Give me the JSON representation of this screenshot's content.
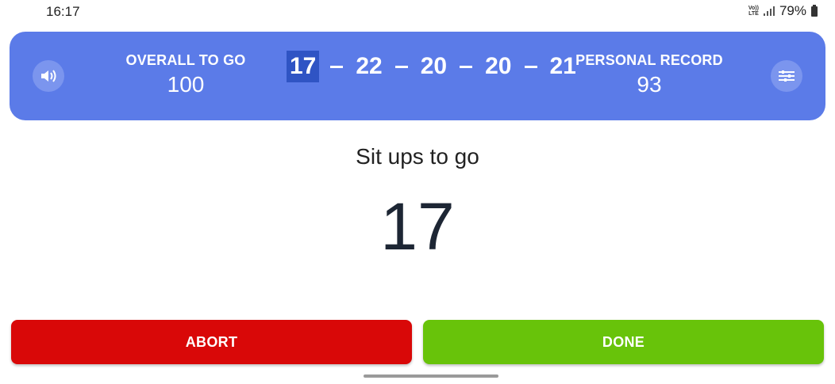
{
  "status_bar": {
    "time": "16:17",
    "network": "Vo)) LTE",
    "battery": "79%"
  },
  "header": {
    "overall_label": "OVERALL TO GO",
    "overall_value": "100",
    "record_label": "PERSONAL RECORD",
    "record_value": "93",
    "sets": [
      "17",
      "22",
      "20",
      "20",
      "21"
    ],
    "current_set_index": 0,
    "sound_icon": "speaker-icon",
    "settings_icon": "sliders-icon"
  },
  "main": {
    "prompt": "Sit ups to go",
    "count": "17"
  },
  "actions": {
    "abort_label": "ABORT",
    "done_label": "DONE"
  },
  "colors": {
    "header_bg": "#5b7be8",
    "abort": "#d90808",
    "done": "#68c30a",
    "current_set_bg": "#2f54c4"
  }
}
